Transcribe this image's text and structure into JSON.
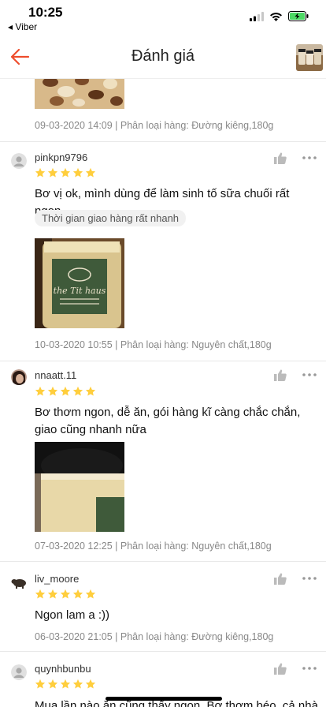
{
  "status": {
    "time": "10:25",
    "back_app": "◂ Viber"
  },
  "header": {
    "title": "Đánh giá"
  },
  "colors": {
    "accent": "#ee4d2d",
    "star": "#ffce3d"
  },
  "reviews": [
    {
      "meta": "09-03-2020 14:09 | Phân loại hàng: Đường kiêng,180g"
    },
    {
      "user": "pinkpn9796",
      "rating": 5,
      "text": "Bơ vị ok, mình dùng để làm sinh tố sữa chuối rất ngon",
      "tag": "Thời gian giao hàng rất nhanh",
      "meta": "10-03-2020 10:55 | Phân loại hàng: Nguyên chất,180g"
    },
    {
      "user": "nnaatt.11",
      "rating": 5,
      "text": "Bơ thơm ngon, dễ ăn, gói hàng kĩ càng chắc chắn, giao cũng nhanh nữa",
      "meta": "07-03-2020 12:25 | Phân loại hàng: Nguyên chất,180g"
    },
    {
      "user": "liv_moore",
      "rating": 5,
      "text": "Ngon lam a :))",
      "meta": "06-03-2020 21:05 | Phân loại hàng: Đường kiêng,180g"
    },
    {
      "user": "quynhbunbu",
      "rating": 5,
      "text": "Mua lần nào ăn cũng thấy ngon. Bơ thơm béo, cả nhà"
    }
  ]
}
